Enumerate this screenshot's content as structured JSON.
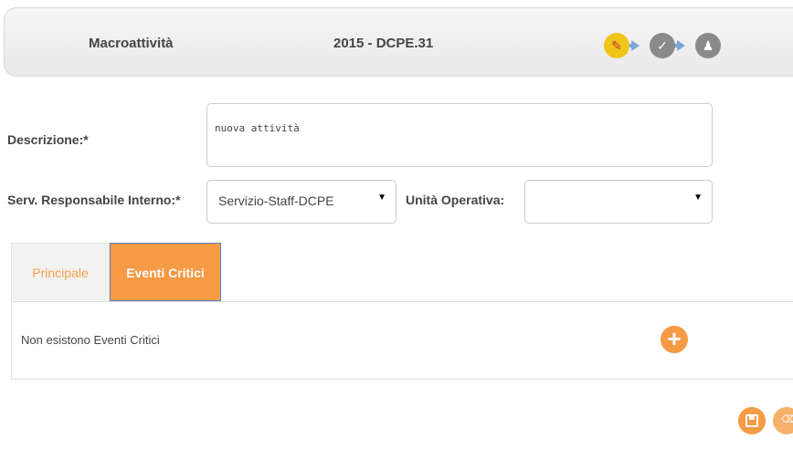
{
  "header": {
    "title": "Macroattività",
    "code": "2015 - DCPE.31",
    "steps": [
      {
        "icon": "pencil-icon",
        "glyph": "✎"
      },
      {
        "icon": "check-icon",
        "glyph": "✓"
      },
      {
        "icon": "person-icon",
        "glyph": "♟"
      }
    ]
  },
  "form": {
    "descrizione_label": "Descrizione:*",
    "descrizione_value": "nuova attività",
    "serv_label": "Serv. Responsabile Interno:*",
    "serv_value": "Servizio-Staff-DCPE",
    "unita_label": "Unità Operativa:",
    "unita_value": "",
    "caret": "▼"
  },
  "tabs": [
    {
      "label": "Principale",
      "active": false
    },
    {
      "label": "Eventi Critici",
      "active": true
    }
  ],
  "panel": {
    "empty_message": "Non esistono Eventi Critici",
    "add_glyph": "+"
  },
  "colors": {
    "accent": "#f59a45",
    "step_active": "#f0c419",
    "step_inactive": "#8a8a8a"
  }
}
